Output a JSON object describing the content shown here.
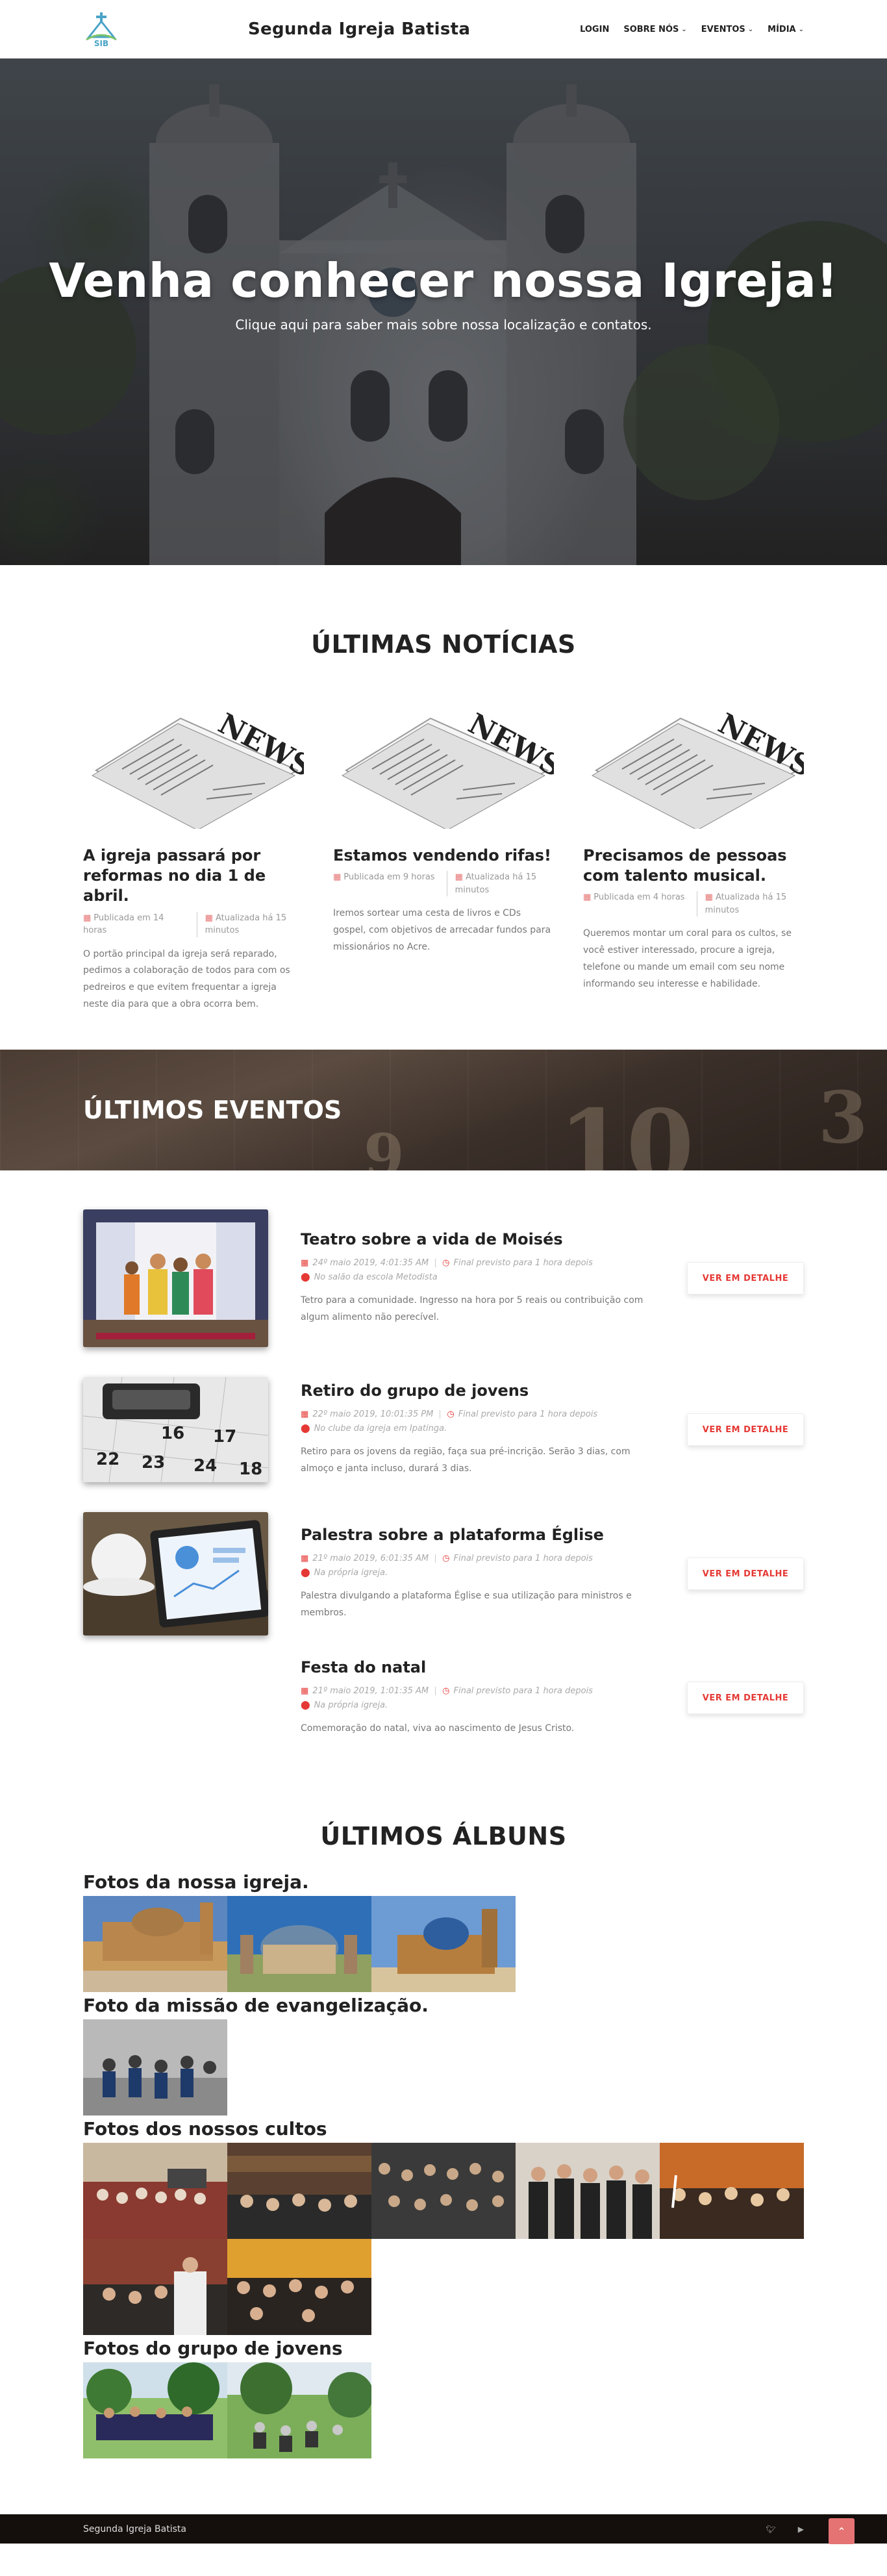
{
  "header": {
    "brand": "Segunda Igreja Batista",
    "nav": [
      {
        "label": "LOGIN",
        "dropdown": false
      },
      {
        "label": "SOBRE NÓS",
        "dropdown": true
      },
      {
        "label": "EVENTOS",
        "dropdown": true
      },
      {
        "label": "MÍDIA",
        "dropdown": true
      }
    ]
  },
  "hero": {
    "title": "Venha conhecer nossa Igreja!",
    "subtitle": "Clique aqui para saber mais sobre nossa localização e contatos."
  },
  "news": {
    "section_title": "ÚLTIMAS NOTÍCIAS",
    "image_word": "NEWS",
    "items": [
      {
        "title": "A igreja passará por reformas no dia 1 de abril.",
        "published": "Publicada em 14 horas",
        "updated": "Atualizada há 15 minutos",
        "text": "O portão principal da igreja será reparado, pedimos a colaboração de todos para com os pedreiros e que evitem frequentar a igreja neste dia para que a obra ocorra bem."
      },
      {
        "title": "Estamos vendendo rifas!",
        "published": "Publicada em 9 horas",
        "updated": "Atualizada há 15 minutos",
        "text": "Iremos sortear uma cesta de livros e CDs gospel, com objetivos de arrecadar fundos para missionários no Acre."
      },
      {
        "title": "Precisamos de pessoas com talento musical.",
        "published": "Publicada em 4 horas",
        "updated": "Atualizada há 15 minutos",
        "text": "Queremos montar um coral para os cultos, se você estiver interessado, procure a igreja, telefone ou mande um email com seu nome informando seu interesse e habilidade."
      }
    ]
  },
  "events": {
    "section_title": "ÚLTIMOS EVENTOS",
    "button_label": "VER EM DETALHE",
    "items": [
      {
        "title": "Teatro sobre a vida de Moisés",
        "date": "24º maio 2019, 4:01:35 AM",
        "end": "Final previsto para 1 hora depois",
        "place": "No salão da escola Metodista",
        "desc": "Tetro para a comunidade. Ingresso na hora por 5 reais ou contribuição com algum alimento não perecível.",
        "image": "theater"
      },
      {
        "title": "Retiro do grupo de jovens",
        "date": "22º maio 2019, 10:01:35 PM",
        "end": "Final previsto para 1 hora depois",
        "place": "No clube da igreja em Ipatinga.",
        "desc": "Retiro para os jovens da região, faça sua pré-incrição. Serão 3 dias, com almoço e janta incluso, durará 3 dias.",
        "image": "calendar"
      },
      {
        "title": "Palestra sobre a plataforma Église",
        "date": "21º maio 2019, 6:01:35 AM",
        "end": "Final previsto para 1 hora depois",
        "place": "Na própria igreja.",
        "desc": "Palestra divulgando a plataforma Église e sua utilização para ministros e membros.",
        "image": "tablet"
      },
      {
        "title": "Festa do natal",
        "date": "21º maio 2019, 1:01:35 AM",
        "end": "Final previsto para 1 hora depois",
        "place": "Na própria igreja.",
        "desc": "Comemoração do natal, viva ao nascimento de Jesus Cristo.",
        "image": ""
      }
    ]
  },
  "albums": {
    "section_title": "ÚLTIMOS ÁLBUNS",
    "items": [
      {
        "title": "Fotos da nossa igreja.",
        "photos": 3,
        "style": "church"
      },
      {
        "title": "Foto da missão de evangelização.",
        "photos": 1,
        "style": "mission"
      },
      {
        "title": "Fotos dos nossos cultos",
        "photos": 6,
        "style": "crowd"
      },
      {
        "title": "Fotos do grupo de jovens",
        "photos": 2,
        "style": "youth"
      }
    ]
  },
  "footer": {
    "text": "Segunda Igreja Batista",
    "icons": [
      "twitter-icon",
      "youtube-icon"
    ]
  },
  "colors": {
    "accent": "#e53935",
    "footer_bg": "#140f0d"
  }
}
